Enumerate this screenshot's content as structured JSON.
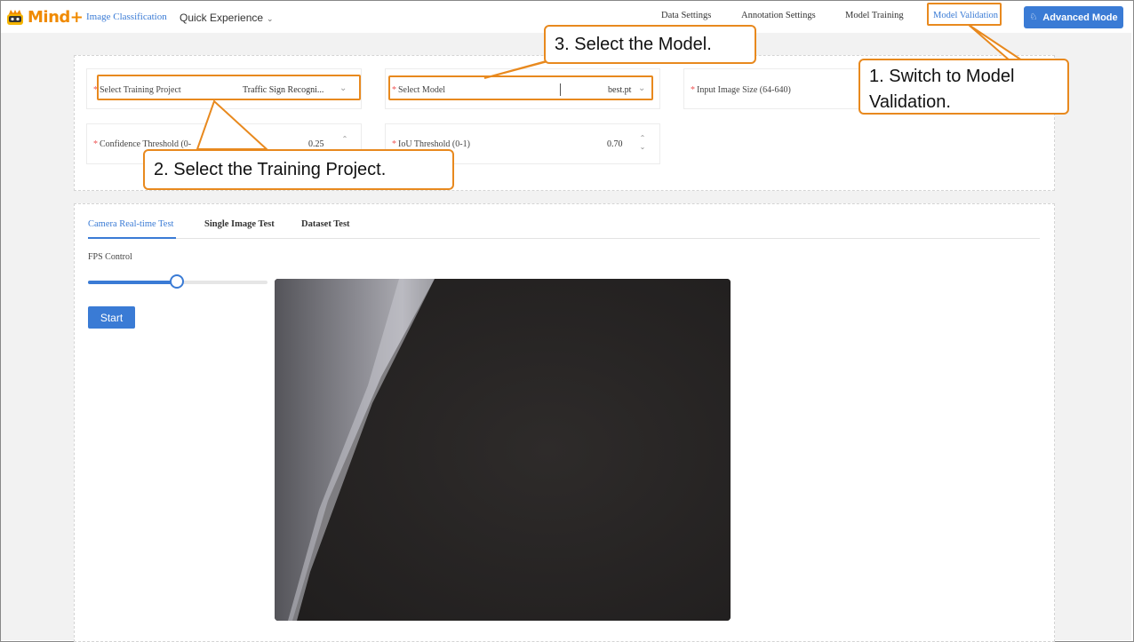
{
  "header": {
    "logo_text": "Mind+",
    "nav_left": [
      "Image Classification",
      "Quick Experience"
    ],
    "nav_right": [
      "Data Settings",
      "Annotation Settings",
      "Model Training",
      "Model Validation"
    ],
    "active_nav": "Model Validation",
    "advanced_button": "Advanced Mode"
  },
  "form": {
    "training_project": {
      "label": "Select Training Project",
      "value": "Traffic Sign Recogni..."
    },
    "model": {
      "label": "Select Model",
      "value": "best.pt"
    },
    "input_size": {
      "label": "Input Image Size (64-640)",
      "value": ""
    },
    "confidence": {
      "label": "Confidence Threshold (0-",
      "value": "0.25"
    },
    "iou": {
      "label": "IoU Threshold (0-1)",
      "value": "0.70"
    }
  },
  "tabs": [
    "Camera Real-time Test",
    "Single Image Test",
    "Dataset Test"
  ],
  "active_tab": "Camera Real-time Test",
  "fps": {
    "label": "FPS Control",
    "level": 0.5
  },
  "start_button": "Start",
  "callouts": {
    "step1": "1. Switch to Model Validation.",
    "step2": "2. Select the Training Project.",
    "step3": "3. Select the Model."
  },
  "colors": {
    "accent": "#3a7bd5",
    "highlight": "#e8891e",
    "brand": "#f08a00"
  }
}
